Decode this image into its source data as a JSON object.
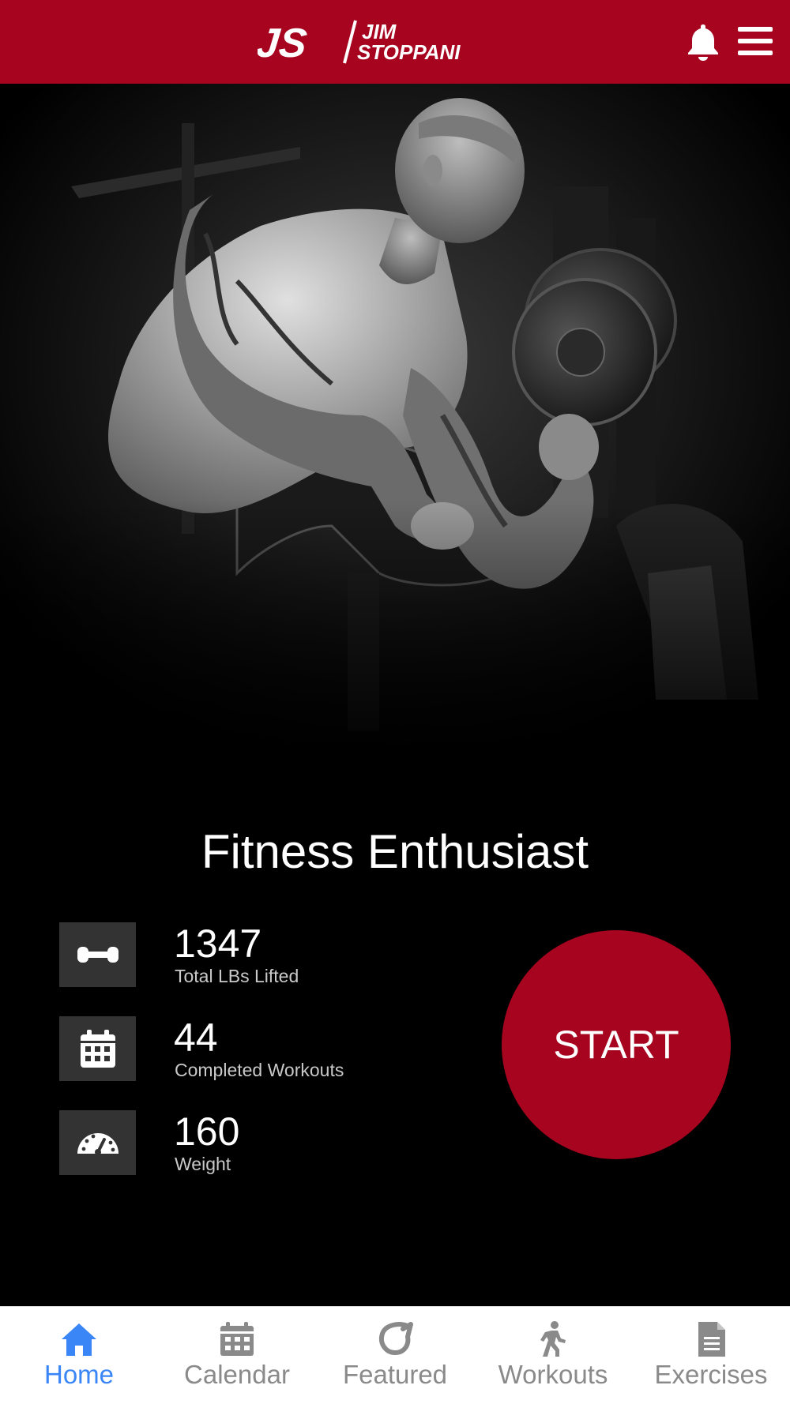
{
  "header": {
    "logo_initials": "JS",
    "logo_name_top": "JIM",
    "logo_name_bottom": "STOPPANI",
    "notification_icon": "bell-icon",
    "menu_icon": "hamburger-menu-icon"
  },
  "hero": {
    "image": "Black-and-white photo of a man doing dumbbell preacher curls"
  },
  "profile": {
    "title": "Fitness Enthusiast",
    "stats": [
      {
        "icon": "dumbbell-icon",
        "value": "1347",
        "label": "Total LBs Lifted"
      },
      {
        "icon": "calendar-icon",
        "value": "44",
        "label": "Completed Workouts"
      },
      {
        "icon": "speedometer-icon",
        "value": "160",
        "label": "Weight"
      }
    ],
    "start_label": "START"
  },
  "nav": {
    "items": [
      {
        "label": "Home",
        "icon": "home-icon",
        "active": true
      },
      {
        "label": "Calendar",
        "icon": "calendar-icon",
        "active": false
      },
      {
        "label": "Featured",
        "icon": "featured-icon",
        "active": false
      },
      {
        "label": "Workouts",
        "icon": "walking-icon",
        "active": false
      },
      {
        "label": "Exercises",
        "icon": "document-icon",
        "active": false
      }
    ]
  },
  "colors": {
    "brand_red": "#a6041f",
    "active_blue": "#3b86f7",
    "inactive_gray": "#8a8a8a",
    "stat_icon_bg": "#333333"
  }
}
